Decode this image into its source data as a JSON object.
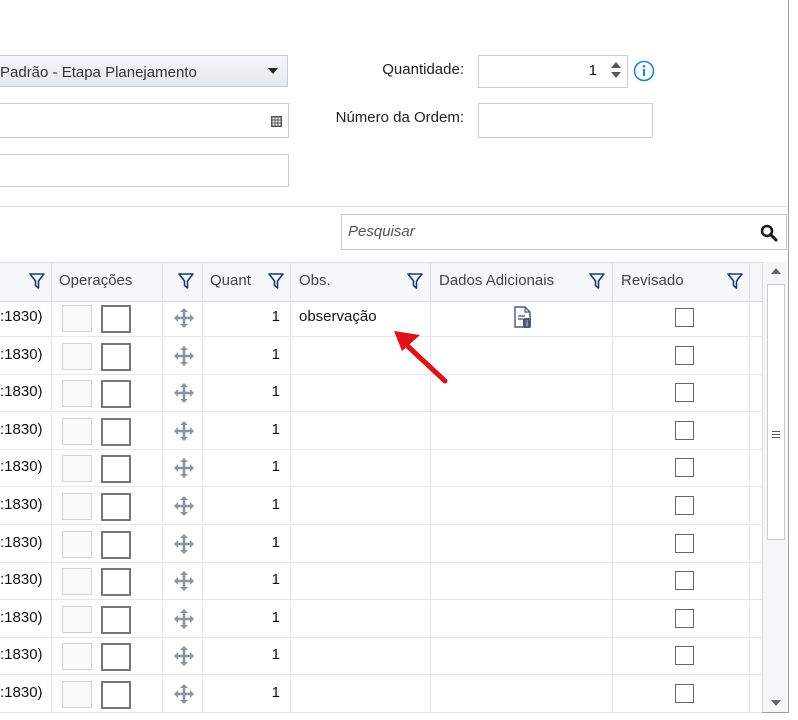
{
  "form": {
    "process_select": "Padrão - Etapa Planejamento",
    "quantity_label": "Quantidade:",
    "quantity_value": "1",
    "order_number_label": "Número da Ordem:",
    "order_number_value": ""
  },
  "search": {
    "placeholder": "Pesquisar"
  },
  "grid": {
    "columns": [
      "Operações",
      "Quant",
      "Obs.",
      "Dados Adicionais",
      "Revisado"
    ],
    "rows": [
      {
        "code": ":1830)",
        "quant": "1",
        "obs": "observação",
        "has_doc": true,
        "revisado": false
      },
      {
        "code": ":1830)",
        "quant": "1",
        "obs": "",
        "has_doc": false,
        "revisado": false
      },
      {
        "code": ":1830)",
        "quant": "1",
        "obs": "",
        "has_doc": false,
        "revisado": false
      },
      {
        "code": ":1830)",
        "quant": "1",
        "obs": "",
        "has_doc": false,
        "revisado": false
      },
      {
        "code": ":1830)",
        "quant": "1",
        "obs": "",
        "has_doc": false,
        "revisado": false
      },
      {
        "code": ":1830)",
        "quant": "1",
        "obs": "",
        "has_doc": false,
        "revisado": false
      },
      {
        "code": ":1830)",
        "quant": "1",
        "obs": "",
        "has_doc": false,
        "revisado": false
      },
      {
        "code": ":1830)",
        "quant": "1",
        "obs": "",
        "has_doc": false,
        "revisado": false
      },
      {
        "code": ":1830)",
        "quant": "1",
        "obs": "",
        "has_doc": false,
        "revisado": false
      },
      {
        "code": ":1830)",
        "quant": "1",
        "obs": "",
        "has_doc": false,
        "revisado": false
      },
      {
        "code": ":1830)",
        "quant": "1",
        "obs": "",
        "has_doc": false,
        "revisado": false
      }
    ]
  },
  "colors": {
    "accent": "#1e7fd6",
    "annotation_arrow": "#e0101a"
  }
}
